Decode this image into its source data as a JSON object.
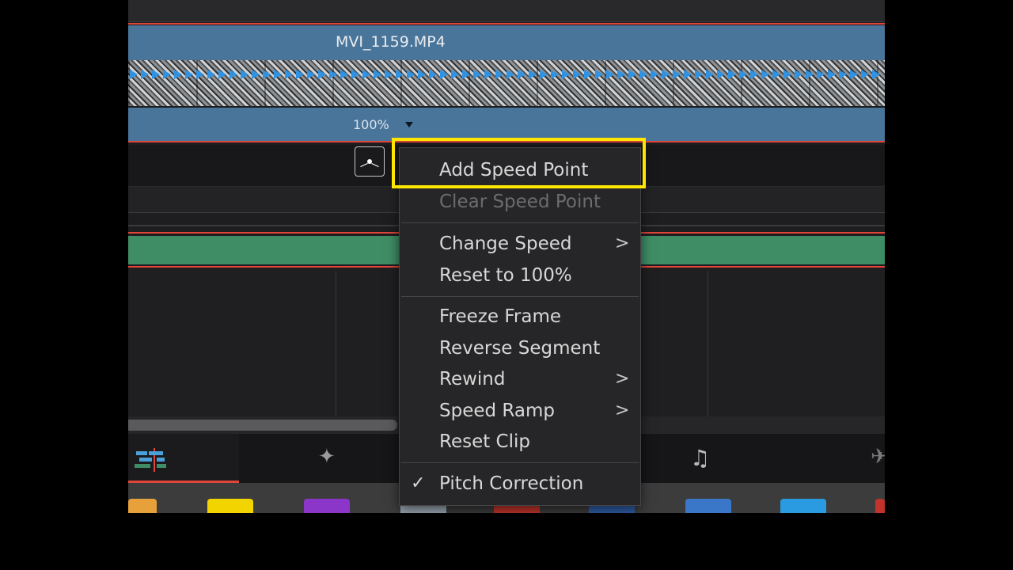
{
  "timeline": {
    "clip_name": "MVI_1159.MP4",
    "speed_percent": "100%"
  },
  "context_menu": {
    "items": [
      {
        "label": "Add Speed Point",
        "enabled": true,
        "highlighted": true
      },
      {
        "label": "Clear Speed Point",
        "enabled": false
      },
      {
        "label": "Change Speed",
        "enabled": true,
        "submenu": true
      },
      {
        "label": "Reset to 100%",
        "enabled": true
      },
      {
        "label": "Freeze Frame",
        "enabled": true
      },
      {
        "label": "Reverse Segment",
        "enabled": true
      },
      {
        "label": "Rewind",
        "enabled": true,
        "submenu": true
      },
      {
        "label": "Speed Ramp",
        "enabled": true,
        "submenu": true
      },
      {
        "label": "Reset Clip",
        "enabled": true
      },
      {
        "label": "Pitch Correction",
        "enabled": true,
        "checked": true
      }
    ],
    "submenu_glyph": ">",
    "check_glyph": "✓"
  },
  "colors": {
    "clip_blue": "#4a759a",
    "audio_green": "#3f8d65",
    "accent_red": "#e0463a",
    "highlight_yellow": "#ffe600"
  },
  "page_tabs": [
    {
      "icon": "edit-page-icon",
      "active": true
    },
    {
      "icon": "fusion-magic-icon"
    },
    {
      "icon": "fairlight-music-icon"
    },
    {
      "icon": "deliver-rocket-icon"
    }
  ]
}
